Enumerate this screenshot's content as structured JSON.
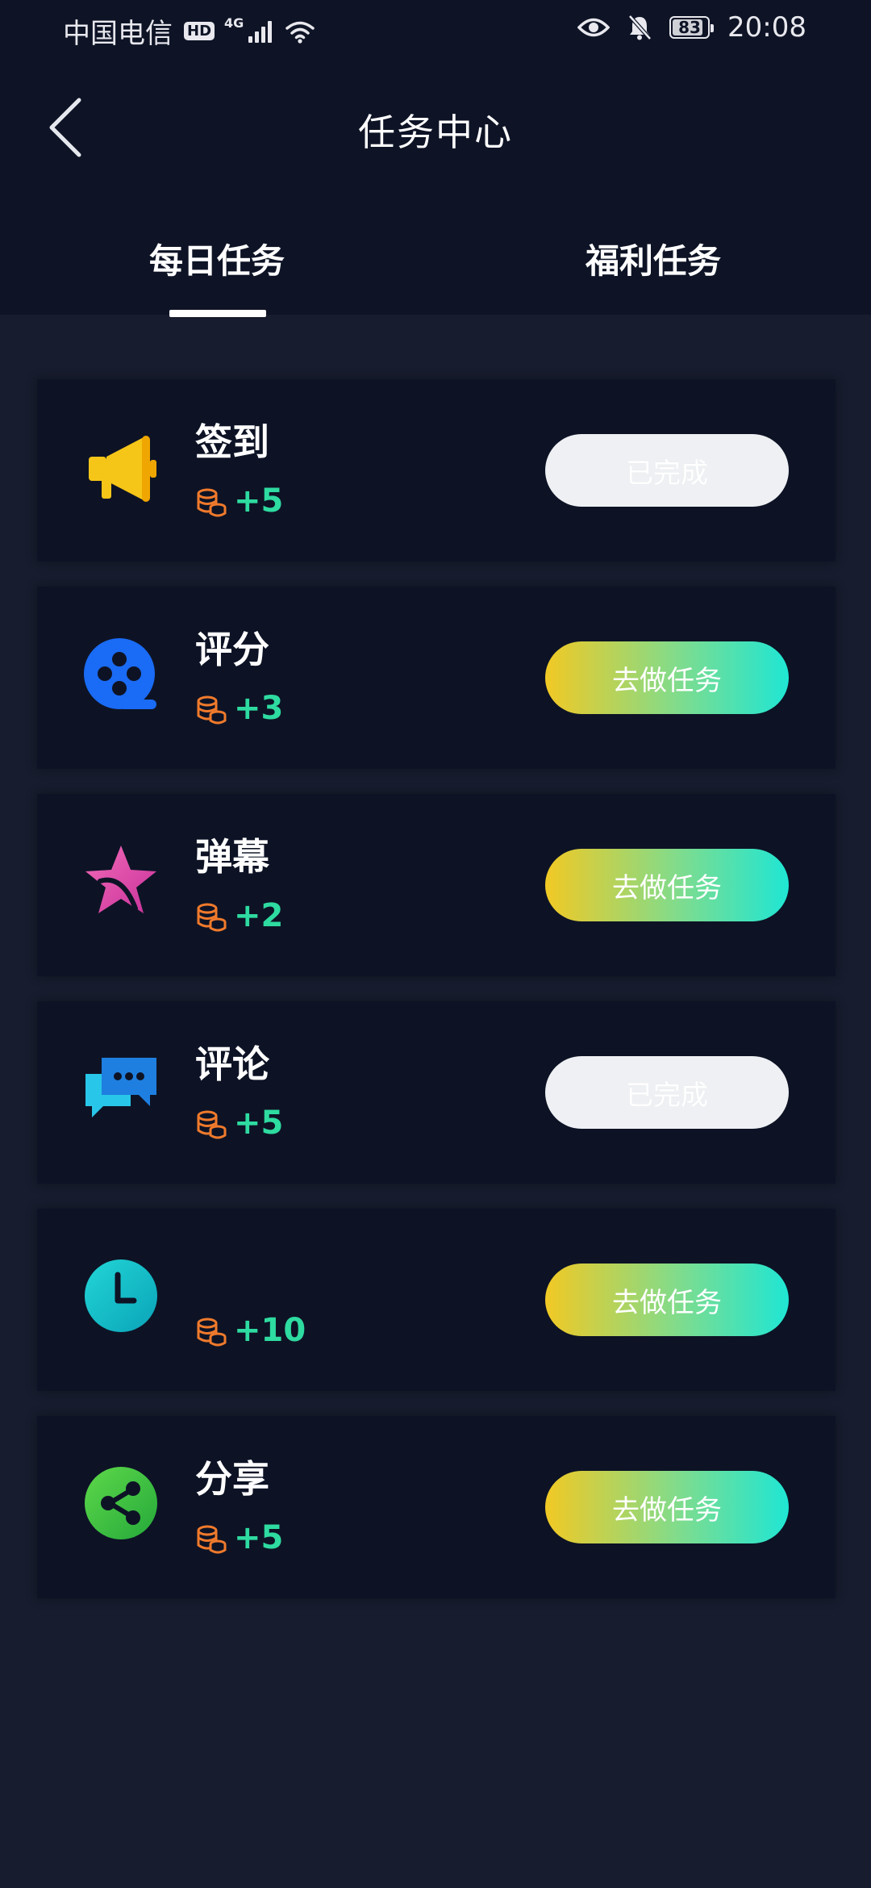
{
  "status_bar": {
    "carrier": "中国电信",
    "hd_badge": "HD",
    "network": "4G",
    "battery": "83",
    "time": "20:08"
  },
  "header": {
    "title": "任务中心",
    "tabs": [
      {
        "label": "每日任务",
        "active": true
      },
      {
        "label": "福利任务",
        "active": false
      }
    ]
  },
  "tasks": [
    {
      "name": "签到",
      "icon": "megaphone-icon",
      "reward": "+5",
      "button": "已完成",
      "status": "done"
    },
    {
      "name": "评分",
      "icon": "film-reel-icon",
      "reward": "+3",
      "button": "去做任务",
      "status": "todo"
    },
    {
      "name": "弹幕",
      "icon": "star-icon",
      "reward": "+2",
      "button": "去做任务",
      "status": "todo"
    },
    {
      "name": "评论",
      "icon": "chat-bubbles-icon",
      "reward": "+5",
      "button": "已完成",
      "status": "done"
    },
    {
      "name": "",
      "icon": "clock-icon",
      "reward": "+10",
      "button": "去做任务",
      "status": "todo"
    },
    {
      "name": "分享",
      "icon": "share-icon",
      "reward": "+5",
      "button": "去做任务",
      "status": "todo"
    }
  ],
  "colors": {
    "background": "#171c2e",
    "header": "#0e1426",
    "card": "#0d1325",
    "reward": "#2edba0",
    "coin": "#f07a2c",
    "button_gradient_start": "#f2c924",
    "button_gradient_end": "#1fe6d4",
    "button_done": "#eef0f3"
  }
}
